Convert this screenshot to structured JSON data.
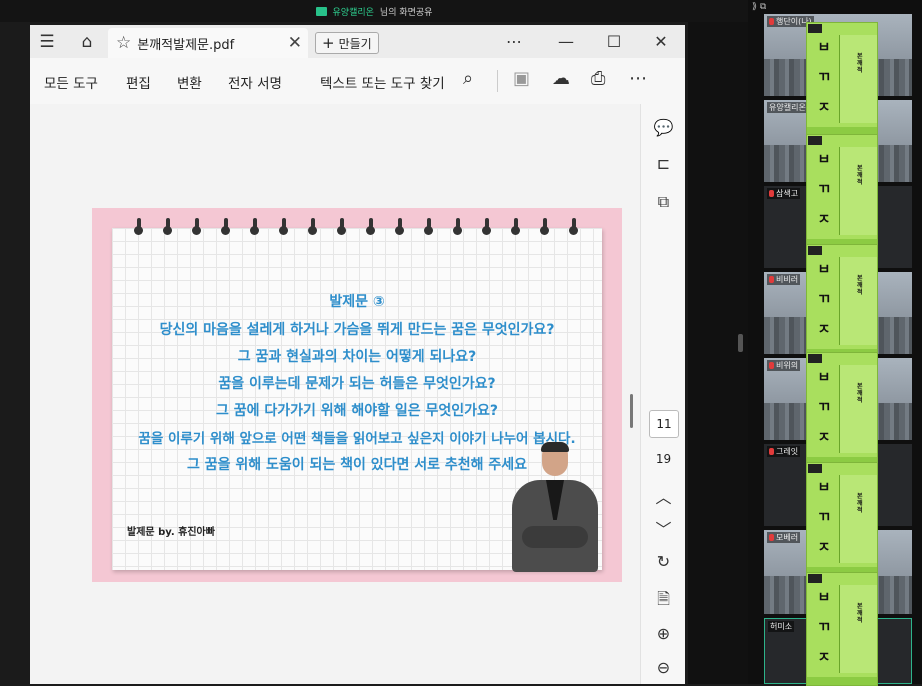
{
  "share_bar": {
    "presenter": "유양캘리온",
    "suffix": "님의 화면공유"
  },
  "window": {
    "tab_title": "본깨적발제문.pdf",
    "new_button": "만들기",
    "toolbar": {
      "all_tools": "모든 도구",
      "edit": "편집",
      "convert": "변환",
      "esign": "전자 서명",
      "search": "텍스트 또는 도구 찾기"
    }
  },
  "page_nav": {
    "current": "11",
    "total": "19"
  },
  "slide": {
    "title": "발제문 ③",
    "lines": [
      "당신의 마음을 설레게 하거나 가슴을 뛰게 만드는 꿈은 무엇인가요?",
      "그 꿈과 현실과의 차이는 어떻게 되나요?",
      "꿈을 이루는데 문제가 되는 허들은 무엇인가요?",
      "그 꿈에 다가가기 위해 해야할 일은 무엇인가요?",
      "꿈을 이루기 위해 앞으로 어떤 책들을 읽어보고 싶은지 이야기 나누어 봅시다.",
      "그 꿈을 위해 도움이 되는 책이 있다면 서로 추천해 주세요"
    ],
    "byline": "발제문 by. 휴진아빠"
  },
  "participants": [
    "행단이(나)",
    "유양캘리온",
    "삼색고",
    "비비러",
    "비위의",
    "그레잇",
    "모베러",
    "허미소"
  ],
  "book_cover": {
    "letters": [
      "ㅂ",
      "ㄲ",
      "ㅈ"
    ],
    "vertical_title": "본깨적"
  },
  "colors": {
    "accent": "#2e8ecb",
    "share_green": "#2ecf8f",
    "book_green": "#a9df5e"
  }
}
